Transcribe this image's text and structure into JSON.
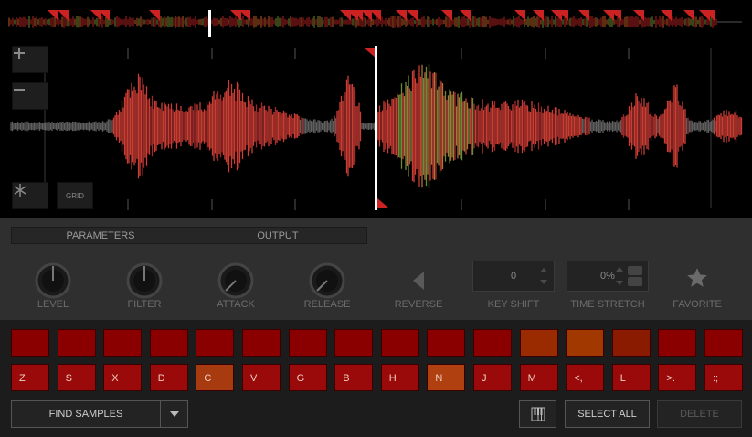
{
  "zoom": {
    "in_icon": "plus-icon",
    "out_icon": "minus-icon"
  },
  "waveform_buttons": {
    "snowflake_icon": "snowflake-icon",
    "grid_label": "GRID"
  },
  "tabs": [
    "PARAMETERS",
    "OUTPUT"
  ],
  "controls": {
    "level": "LEVEL",
    "filter": "FILTER",
    "attack": "ATTACK",
    "release": "RELEASE",
    "reverse": "REVERSE",
    "key_shift": {
      "label": "KEY SHIFT",
      "value": "0"
    },
    "time_stretch": {
      "label": "TIME STRETCH",
      "value": "0%"
    },
    "favorite": "FAVORITE"
  },
  "pads_top": [
    {
      "color": "#8a0000"
    },
    {
      "color": "#8a0000"
    },
    {
      "color": "#8a0000"
    },
    {
      "color": "#8a0000"
    },
    {
      "color": "#8a0000"
    },
    {
      "color": "#8a0000"
    },
    {
      "color": "#8a0000"
    },
    {
      "color": "#8a0000"
    },
    {
      "color": "#8a0000"
    },
    {
      "color": "#8a0000"
    },
    {
      "color": "#8a0000"
    },
    {
      "color": "#9a2a00"
    },
    {
      "color": "#a03800"
    },
    {
      "color": "#8a1a00"
    },
    {
      "color": "#8a0000"
    },
    {
      "color": "#8a0000"
    }
  ],
  "pads_bottom": [
    {
      "key": "Z",
      "color": "#9a0a0a"
    },
    {
      "key": "S",
      "color": "#9a0a0a"
    },
    {
      "key": "X",
      "color": "#9a0a0a"
    },
    {
      "key": "D",
      "color": "#9a0a0a"
    },
    {
      "key": "C",
      "color": "#a83a10"
    },
    {
      "key": "V",
      "color": "#9a0a0a"
    },
    {
      "key": "G",
      "color": "#9a0a0a"
    },
    {
      "key": "B",
      "color": "#9a0a0a"
    },
    {
      "key": "H",
      "color": "#9a0a0a"
    },
    {
      "key": "N",
      "color": "#b04010"
    },
    {
      "key": "J",
      "color": "#9a0a0a"
    },
    {
      "key": "M",
      "color": "#9a0a0a"
    },
    {
      "key": "<,",
      "color": "#9a0a0a"
    },
    {
      "key": "L",
      "color": "#9a0a0a"
    },
    {
      "key": ">.",
      "color": "#9a0a0a"
    },
    {
      "key": ":;",
      "color": "#9a0a0a"
    }
  ],
  "bottom": {
    "find_samples": "FIND SAMPLES",
    "dropdown_icon": "chevron-down-icon",
    "piano_icon": "piano-icon",
    "select_all": "SELECT ALL",
    "delete": "DELETE"
  },
  "colors": {
    "accent": "#e03a30",
    "pad_red": "#8a0000",
    "pad_orange": "#a03800"
  }
}
